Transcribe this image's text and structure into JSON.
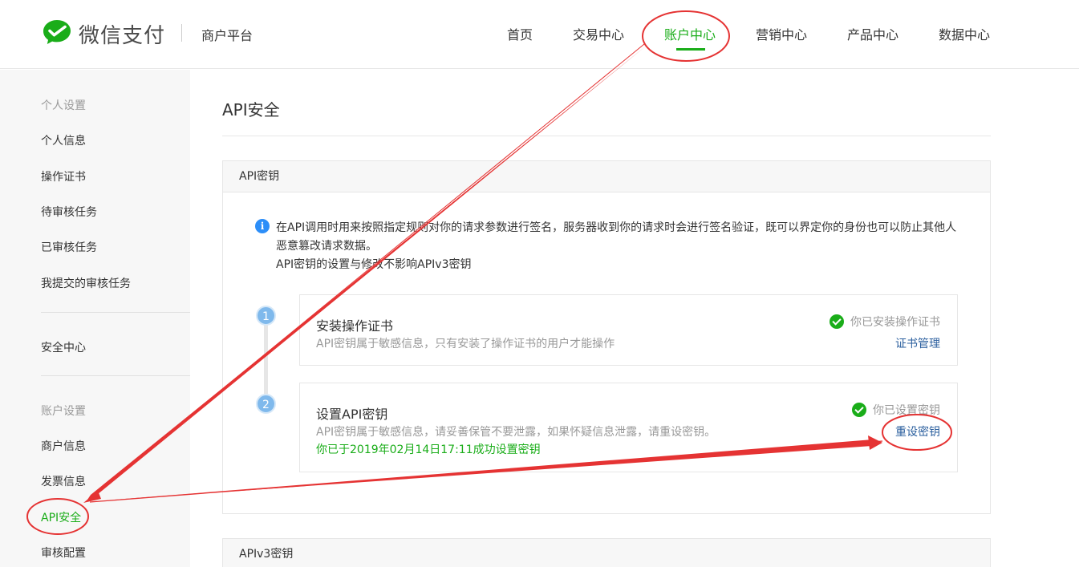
{
  "header": {
    "brand": "微信支付",
    "platform": "商户平台",
    "nav": [
      "首页",
      "交易中心",
      "账户中心",
      "营销中心",
      "产品中心",
      "数据中心"
    ],
    "active_nav": "账户中心"
  },
  "sidebar": {
    "group_personal": "个人设置",
    "personal_items": [
      "个人信息",
      "操作证书",
      "待审核任务",
      "已审核任务",
      "我提交的审核任务"
    ],
    "security_center": "安全中心",
    "group_account": "账户设置",
    "account_items": [
      "商户信息",
      "发票信息",
      "API安全",
      "审核配置"
    ],
    "active_item": "API安全"
  },
  "main": {
    "title": "API安全",
    "api_key_panel": {
      "heading": "API密钥",
      "info_icon": "i",
      "info_lines": [
        "在API调用时用来按照指定规则对你的请求参数进行签名，服务器收到你的请求时会进行签名验证，既可以界定你的身份也可以防止其他人",
        "恶意篡改请求数据。",
        "API密钥的设置与修改不影响APIv3密钥"
      ],
      "steps": [
        {
          "num": "1",
          "title": "安装操作证书",
          "desc": "API密钥属于敏感信息，只有安装了操作证书的用户才能操作",
          "status": "你已安装操作证书",
          "action": "证书管理"
        },
        {
          "num": "2",
          "title": "设置API密钥",
          "desc": "API密钥属于敏感信息，请妥善保管不要泄露，如果怀疑信息泄露，请重设密钥。",
          "note": "你已于2019年02月14日17:11成功设置密钥",
          "status": "你已设置密钥",
          "action": "重设密钥"
        }
      ]
    },
    "apiv3_panel": {
      "heading": "APIv3密钥"
    }
  },
  "colors": {
    "brand_green": "#1aad19",
    "link_blue": "#2b5f9e",
    "annotation_red": "#e53333"
  }
}
